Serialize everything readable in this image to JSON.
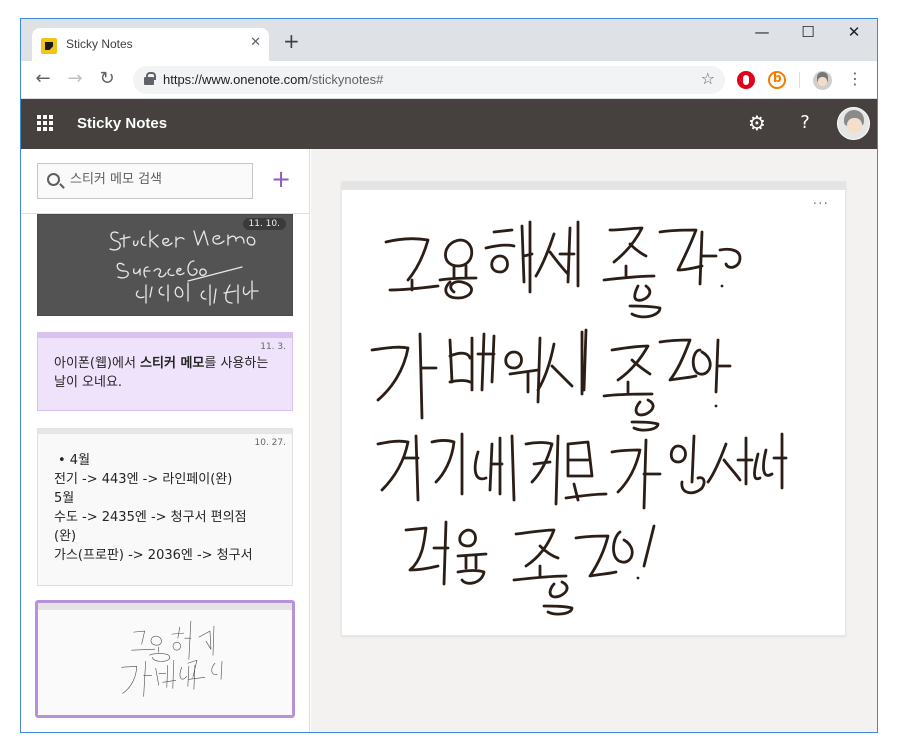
{
  "browser": {
    "tab_title": "Sticky Notes",
    "tab_close": "✕",
    "new_tab": "+",
    "window_controls": {
      "minimize": "—",
      "maximize": "☐",
      "close": "✕"
    },
    "url_main": "https://www.onenote.com",
    "url_path": "/stickynotes#",
    "star": "☆",
    "nav": {
      "back": "←",
      "forward": "→",
      "reload": "↻"
    },
    "menu": "⋮"
  },
  "app": {
    "title": "Sticky Notes",
    "settings_icon": "⚙",
    "help_icon": "?"
  },
  "sidebar": {
    "search_placeholder": "스티커 메모 검색",
    "add_label": "+",
    "notes": [
      {
        "type": "ink",
        "date": "11. 10.",
        "color": "#535353"
      },
      {
        "type": "text",
        "date": "11. 3.",
        "color": "#efe2fb",
        "text_before": "아이폰(웹)에서 ",
        "text_bold": "스티커 메모",
        "text_after": "를 사용하는 날이 오네요."
      },
      {
        "type": "text",
        "date": "10. 27.",
        "color": "#f9f9f9",
        "lines": [
          "•  4월",
          "전기 -> 443엔 -> 라인페이(완)",
          "5월",
          "수도 -> 2435엔 -> 청구서 편의점",
          "(완)",
          "가스(프로판) -> 2036엔 -> 청구서"
        ]
      },
      {
        "type": "ink",
        "date": "",
        "color": "#fafafa",
        "selected": true
      }
    ]
  },
  "editor": {
    "more_label": "···"
  }
}
